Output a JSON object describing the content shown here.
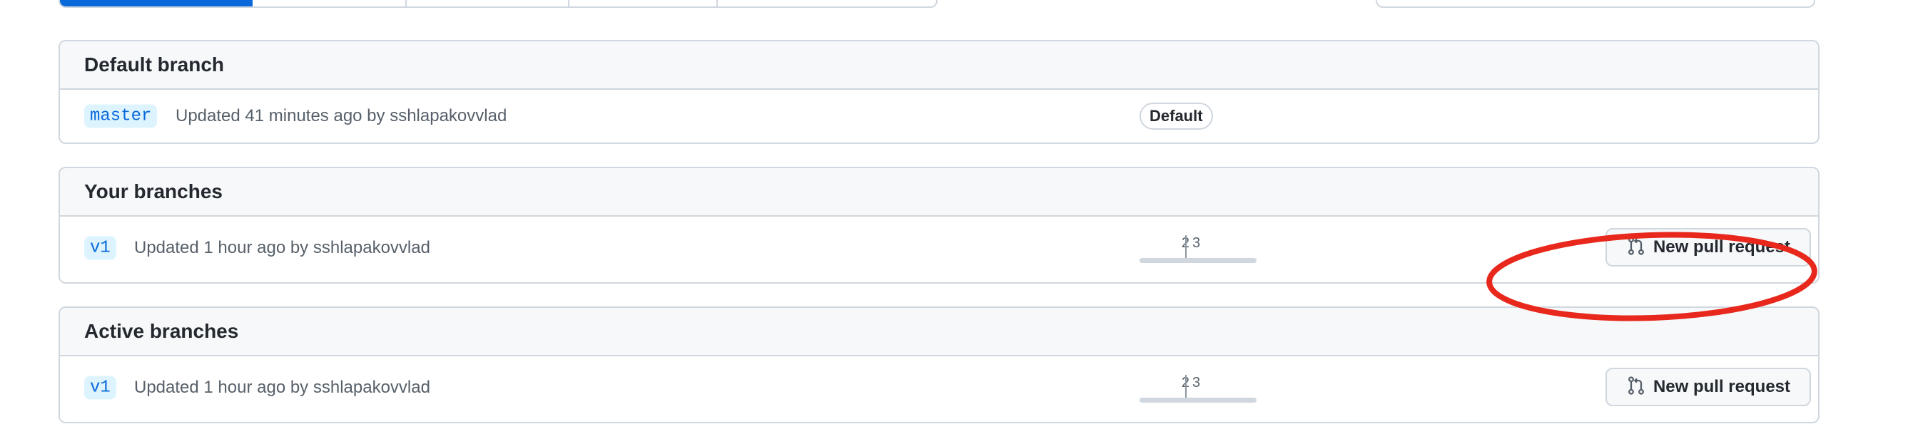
{
  "sections": {
    "default": {
      "title": "Default branch",
      "rows": [
        {
          "branch": "master",
          "updated": "Updated 41 minutes ago by sshlapakovvlad",
          "label": "Default"
        }
      ]
    },
    "yours": {
      "title": "Your branches",
      "rows": [
        {
          "branch": "v1",
          "updated": "Updated 1 hour ago by sshlapakovvlad",
          "behind": "2",
          "ahead": "3",
          "pr_label": "New pull request"
        }
      ]
    },
    "active": {
      "title": "Active branches",
      "rows": [
        {
          "branch": "v1",
          "updated": "Updated 1 hour ago by sshlapakovvlad",
          "behind": "2",
          "ahead": "3",
          "pr_label": "New pull request"
        }
      ]
    }
  },
  "icons": {
    "pull_request": "git-pull-request-icon",
    "delete": "trash-icon"
  },
  "colors": {
    "link": "#0969da",
    "danger": "#cf222e",
    "annotation": "#e8281c",
    "border": "#d0d7de",
    "header_bg": "#f6f8fa"
  }
}
